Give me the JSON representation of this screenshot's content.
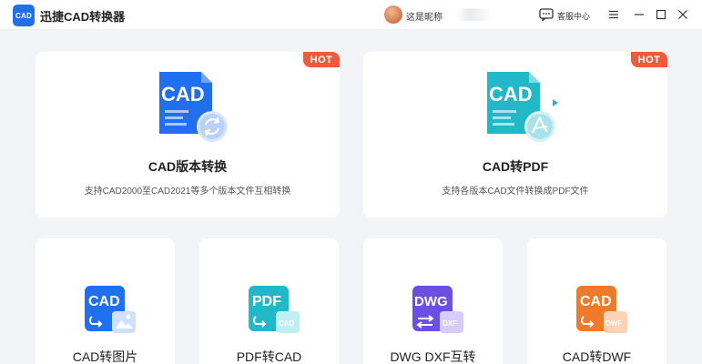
{
  "app": {
    "logo_text": "CAD",
    "title": "迅捷CAD转换器"
  },
  "user": {
    "nickname": "这是昵称"
  },
  "titlebar": {
    "service_label": "客服中心"
  },
  "features_top": [
    {
      "badge": "HOT",
      "icon_text": "CAD",
      "title": "CAD版本转换",
      "description": "支持CAD2000至CAD2021等多个版本文件互相转换",
      "icon": "cad-refresh-icon"
    },
    {
      "badge": "HOT",
      "icon_text": "CAD",
      "title": "CAD转PDF",
      "description": "支持各版本CAD文件转换成PDF文件",
      "icon": "cad-pdf-icon"
    }
  ],
  "features_bottom": [
    {
      "icon_text": "CAD",
      "sub_text": "",
      "title": "CAD转图片",
      "color": "#1f6ff0",
      "icon": "cad-image-icon"
    },
    {
      "icon_text": "PDF",
      "sub_text": "CAD",
      "title": "PDF转CAD",
      "color": "#22b8c8",
      "icon": "pdf-cad-icon"
    },
    {
      "icon_text": "DWG",
      "sub_text": "DXF",
      "title": "DWG DXF互转",
      "color": "#6a4fe0",
      "icon": "dwg-dxf-icon"
    },
    {
      "icon_text": "CAD",
      "sub_text": "DWF",
      "title": "CAD转DWF",
      "color": "#f07a2c",
      "icon": "cad-dwf-icon"
    }
  ],
  "colors": {
    "brand": "#1f6ff0",
    "hot": "#f05a3c",
    "background": "#f2f4f8"
  }
}
